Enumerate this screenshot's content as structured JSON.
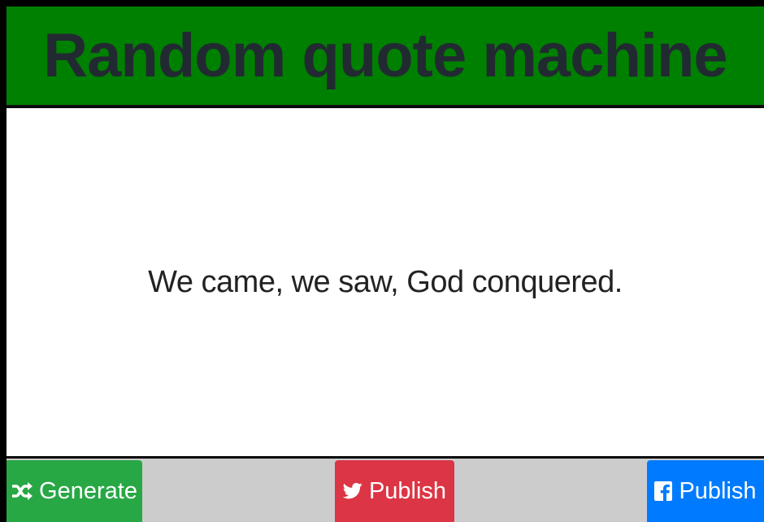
{
  "header": {
    "title": "Random quote machine"
  },
  "quote": {
    "text": "We came, we saw, God conquered."
  },
  "footer": {
    "generate_label": "Generate",
    "generate_icon": "shuffle-icon",
    "twitter_label": "Publish",
    "twitter_icon": "twitter-icon",
    "facebook_label": "Publish",
    "facebook_icon": "facebook-icon"
  },
  "colors": {
    "header_bg": "#008000",
    "title_text": "#222a31",
    "footer_bg": "#cccccc",
    "generate_bg": "#28a745",
    "twitter_bg": "#dc3545",
    "facebook_bg": "#007bff"
  }
}
